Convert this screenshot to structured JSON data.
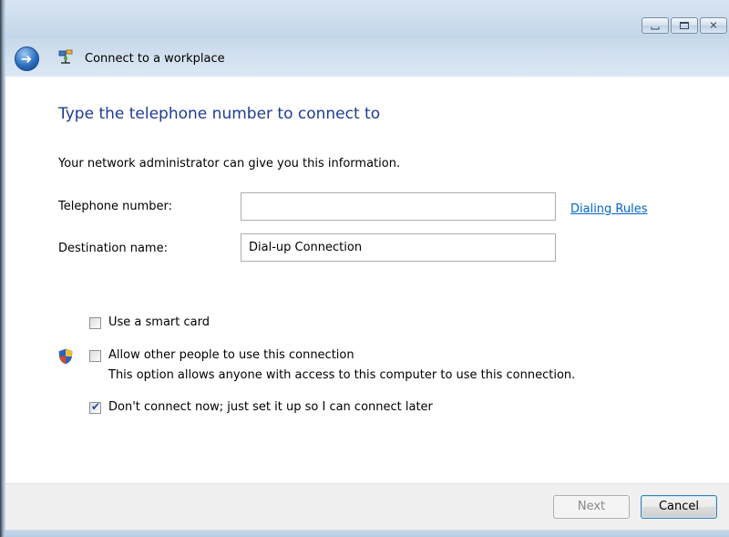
{
  "window": {
    "title": "Connect to a workplace",
    "controls": {
      "minimize": "minimize",
      "maximize": "maximize",
      "close": "close"
    }
  },
  "page": {
    "heading": "Type the telephone number to connect to",
    "info": "Your network administrator can give you this information."
  },
  "form": {
    "telephone_label": "Telephone number:",
    "telephone_value": "",
    "dialing_rules_link": "Dialing Rules",
    "destination_label": "Destination name:",
    "destination_value": "Dial-up Connection"
  },
  "options": {
    "smart_card": {
      "label": "Use a smart card",
      "checked": false
    },
    "allow_others": {
      "label": "Allow other people to use this connection",
      "description": "This option allows anyone with access to this computer to use this connection.",
      "checked": false,
      "icon": "uac-shield-icon"
    },
    "connect_later": {
      "label": "Don't connect now; just set it up so I can connect later",
      "checked": true
    }
  },
  "buttons": {
    "next": "Next",
    "cancel": "Cancel"
  },
  "colors": {
    "heading": "#1e3b91",
    "link": "#0066cc",
    "frame": "#c6d8ea"
  }
}
